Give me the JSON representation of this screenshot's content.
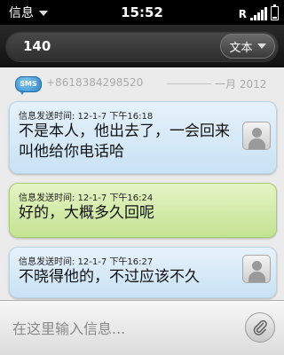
{
  "status_bar": {
    "app_menu_label": "信息",
    "time": "15:52",
    "roaming_indicator": "R"
  },
  "header": {
    "recipient": "140",
    "type_select": {
      "selected": "文本"
    }
  },
  "conversation": {
    "divider": {
      "phone": "+8618384298520",
      "date": "一月 2012"
    },
    "messages": [
      {
        "direction": "incoming",
        "meta": "信息发送时间: 12-1-7 下午16:18",
        "text": "不是本人，他出去了，一会回来叫他给你电话哈"
      },
      {
        "direction": "outgoing",
        "meta": "信息发送时间: 12-1-7 下午16:24",
        "text": "好的，大概多久回呢"
      },
      {
        "direction": "incoming",
        "meta": "信息发送时间: 12-1-7 下午16:27",
        "text": "不晓得他的，不过应该不久"
      }
    ]
  },
  "compose": {
    "placeholder": "在这里输入信息..."
  },
  "colors": {
    "incoming_bubble": "#c9e2f4",
    "outgoing_bubble": "#c4e393",
    "sms_badge": "#2e86c8"
  },
  "icons": {
    "status": [
      "signal-icon",
      "battery-icon"
    ],
    "avatar": "contact-avatar-icon",
    "sms": "sms-icon",
    "attach": "paperclip-icon"
  }
}
